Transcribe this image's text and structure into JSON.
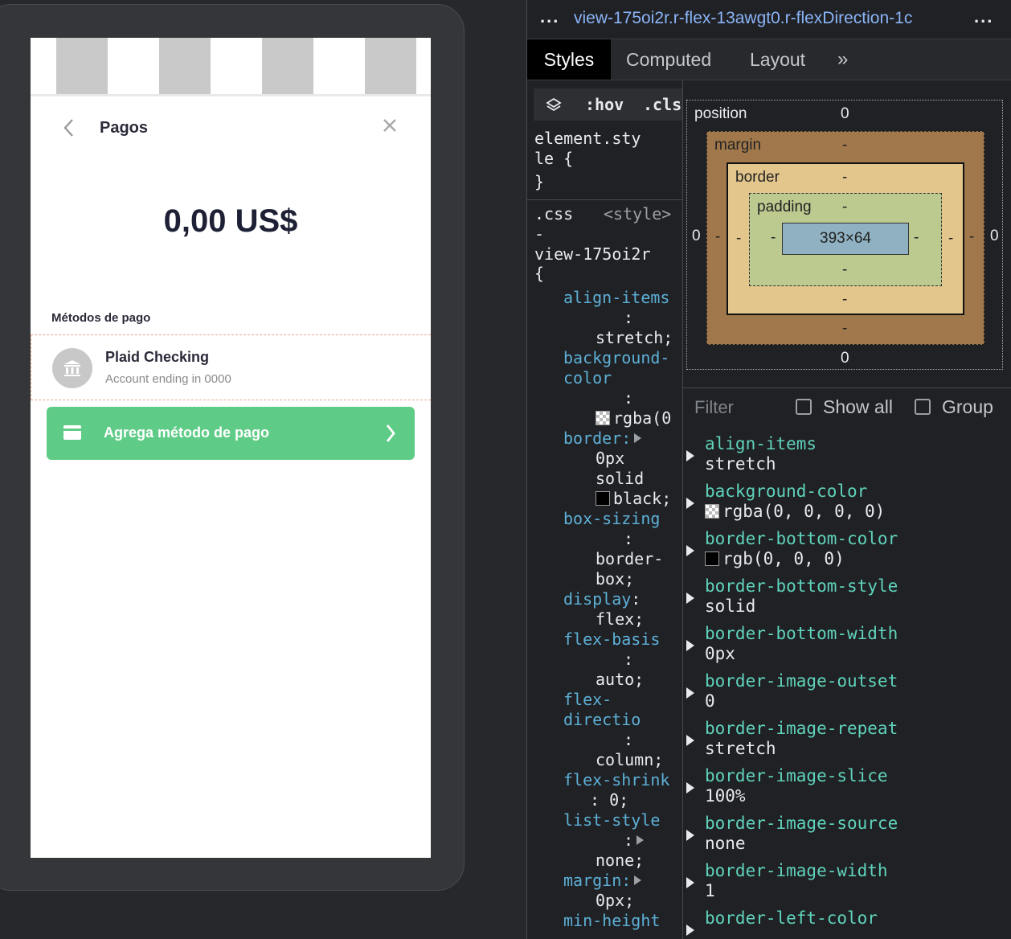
{
  "app": {
    "title": "Pagos",
    "amount": "0,00 US$",
    "section_label": "Métodos de pago",
    "method": {
      "name": "Plaid Checking",
      "detail": "Account ending in 0000"
    },
    "add_button_label": "Agrega método de pago",
    "colors": {
      "primary_green": "#5ecc86",
      "title_text": "#1e2136"
    }
  },
  "devtools": {
    "breadcrumb_left_dots": "...",
    "breadcrumb_text": "view-175oi2r.r-flex-13awgt0.r-flexDirection-1c",
    "breadcrumb_right_dots": "...",
    "tabs": [
      "Styles",
      "Computed",
      "Layout",
      "»"
    ],
    "active_tab": "Styles",
    "toolbar": {
      "hov": ":hov",
      "cls": ".cls"
    },
    "box_model": {
      "position_label": "position",
      "position_value": "0",
      "margin_label": "margin",
      "border_label": "border",
      "padding_label": "padding",
      "content_size": "393×64",
      "dash": "-",
      "zero": "0"
    },
    "filter": {
      "placeholder": "Filter",
      "show_all": "Show all",
      "group": "Group"
    },
    "computed": [
      {
        "name": "align-items",
        "value": "stretch"
      },
      {
        "name": "background-color",
        "value": "rgba(0, 0, 0, 0)"
      },
      {
        "name": "border-bottom-color",
        "value": "rgb(0, 0, 0)"
      },
      {
        "name": "border-bottom-style",
        "value": "solid"
      },
      {
        "name": "border-bottom-width",
        "value": "0px"
      },
      {
        "name": "border-image-outset",
        "value": "0"
      },
      {
        "name": "border-image-repeat",
        "value": "stretch"
      },
      {
        "name": "border-image-slice",
        "value": "100%"
      },
      {
        "name": "border-image-source",
        "value": "none"
      },
      {
        "name": "border-image-width",
        "value": "1"
      },
      {
        "name": "border-left-color",
        "value": ""
      }
    ],
    "styles": {
      "element_style_1": "element.sty",
      "element_style_2": "le {",
      "element_style_close": "}",
      "rule_source_file": ".css",
      "rule_source_style": "<style>",
      "rule_dash": "-",
      "rule_selector": "view-175oi2r",
      "rule_open": "{",
      "lines": [
        {
          "p": "align-items",
          "v": ""
        },
        {
          "p": "",
          "v": ":"
        },
        {
          "p": "",
          "v": "stretch;"
        },
        {
          "p": "background-",
          "v": ""
        },
        {
          "p": "color",
          "v": ""
        },
        {
          "p": "",
          "v": ":"
        },
        {
          "p": "",
          "v": "rgba(0"
        },
        {
          "p": "border:",
          "v": ""
        },
        {
          "p": "",
          "v": "0px"
        },
        {
          "p": "",
          "v": "solid"
        },
        {
          "p": "",
          "v": "black;"
        },
        {
          "p": "box-sizing",
          "v": ""
        },
        {
          "p": "",
          "v": ":"
        },
        {
          "p": "",
          "v": "border-"
        },
        {
          "p": "",
          "v": "box;"
        },
        {
          "p": "display",
          "v": ":"
        },
        {
          "p": "",
          "v": "flex;"
        },
        {
          "p": "flex-basis",
          "v": ""
        },
        {
          "p": "",
          "v": ":"
        },
        {
          "p": "",
          "v": "auto;"
        },
        {
          "p": "flex-",
          "v": ""
        },
        {
          "p": "directio",
          "v": ""
        },
        {
          "p": "",
          "v": ":"
        },
        {
          "p": "",
          "v": "column;"
        },
        {
          "p": "flex-shrink",
          "v": ""
        },
        {
          "p": "",
          "v": ": 0;"
        },
        {
          "p": "list-style",
          "v": ""
        },
        {
          "p": "",
          "v": ":"
        },
        {
          "p": "",
          "v": "none;"
        },
        {
          "p": "margin:",
          "v": ""
        },
        {
          "p": "",
          "v": "0px;"
        },
        {
          "p": "min-height",
          "v": ""
        }
      ]
    }
  }
}
